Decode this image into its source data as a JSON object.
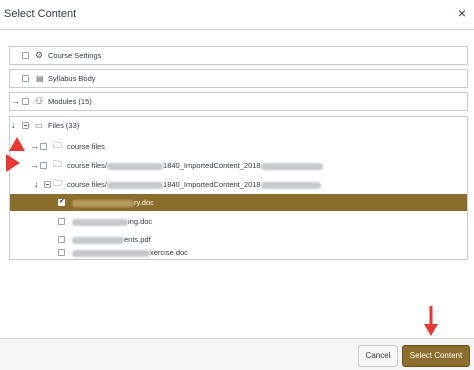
{
  "dialog": {
    "title": "Select Content",
    "close_glyph": "×"
  },
  "rows": [
    {
      "label": "Course Settings",
      "icon": "gear-icon"
    },
    {
      "label": "Syllabus Body",
      "icon": "document-icon"
    },
    {
      "label": "Modules (15)",
      "icon": "modules-icon"
    }
  ],
  "files": {
    "root_label": "Files (33)",
    "items": [
      {
        "label": "course files",
        "selected": false
      },
      {
        "label_prefix": "course files/",
        "label_mid": "1840_ImportedContent_2018",
        "selected": false
      },
      {
        "label_prefix": "course files/",
        "label_mid": "1840_ImportedContent_2018",
        "selected": false
      },
      {
        "label_suffix": "ry.doc",
        "selected": true
      },
      {
        "label_suffix": "ing.doc",
        "selected": false
      },
      {
        "label_suffix": "ents.pdf",
        "selected": false
      },
      {
        "label_suffix": "xercise.doc",
        "selected": false
      }
    ]
  },
  "footer": {
    "cancel_label": "Cancel",
    "select_label": "Select Content"
  },
  "colors": {
    "accent": "#8b6d2d",
    "annotation_red": "#e53935"
  }
}
